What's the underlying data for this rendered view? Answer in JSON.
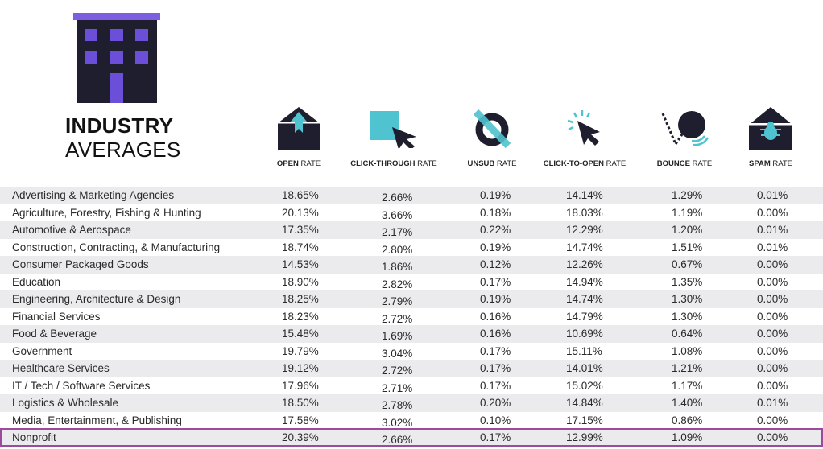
{
  "header": {
    "title_bold": "INDUSTRY",
    "title_light": "AVERAGES",
    "icon": "building-icon"
  },
  "colors": {
    "dark": "#1f1e2e",
    "accent_purple": "#6b4fd8",
    "accent_teal": "#4fc3cf",
    "highlight_border": "#9b4a9e",
    "row_shade": "#ebebed"
  },
  "columns": [
    {
      "bold": "OPEN",
      "light": " RATE",
      "icon": "envelope-open-icon"
    },
    {
      "bold": "CLICK-THROUGH",
      "light": " RATE",
      "icon": "cursor-click-icon"
    },
    {
      "bold": "UNSUB",
      "light": " RATE",
      "icon": "unsubscribe-icon"
    },
    {
      "bold": "CLICK-TO-OPEN",
      "light": " RATE",
      "icon": "cursor-sparkle-icon"
    },
    {
      "bold": "BOUNCE",
      "light": " RATE",
      "icon": "bounce-ball-icon"
    },
    {
      "bold": "SPAM",
      "light": " RATE",
      "icon": "envelope-bug-icon"
    }
  ],
  "rows": [
    {
      "industry": "Advertising & Marketing Agencies",
      "open": "18.65%",
      "ctr": "2.66%",
      "unsub": "0.19%",
      "cto": "14.14%",
      "bounce": "1.29%",
      "spam": "0.01%"
    },
    {
      "industry": "Agriculture, Forestry, Fishing & Hunting",
      "open": "20.13%",
      "ctr": "3.66%",
      "unsub": "0.18%",
      "cto": "18.03%",
      "bounce": "1.19%",
      "spam": "0.00%"
    },
    {
      "industry": "Automotive & Aerospace",
      "open": "17.35%",
      "ctr": "2.17%",
      "unsub": "0.22%",
      "cto": "12.29%",
      "bounce": "1.20%",
      "spam": "0.01%"
    },
    {
      "industry": "Construction, Contracting, & Manufacturing",
      "open": "18.74%",
      "ctr": "2.80%",
      "unsub": "0.19%",
      "cto": "14.74%",
      "bounce": "1.51%",
      "spam": "0.01%"
    },
    {
      "industry": "Consumer Packaged Goods",
      "open": "14.53%",
      "ctr": "1.86%",
      "unsub": "0.12%",
      "cto": "12.26%",
      "bounce": "0.67%",
      "spam": "0.00%"
    },
    {
      "industry": "Education",
      "open": "18.90%",
      "ctr": "2.82%",
      "unsub": "0.17%",
      "cto": "14.94%",
      "bounce": "1.35%",
      "spam": "0.00%"
    },
    {
      "industry": "Engineering, Architecture & Design",
      "open": "18.25%",
      "ctr": "2.79%",
      "unsub": "0.19%",
      "cto": "14.74%",
      "bounce": "1.30%",
      "spam": "0.00%"
    },
    {
      "industry": "Financial Services",
      "open": "18.23%",
      "ctr": "2.72%",
      "unsub": "0.16%",
      "cto": "14.79%",
      "bounce": "1.30%",
      "spam": "0.00%"
    },
    {
      "industry": "Food & Beverage",
      "open": "15.48%",
      "ctr": "1.69%",
      "unsub": "0.16%",
      "cto": "10.69%",
      "bounce": "0.64%",
      "spam": "0.00%"
    },
    {
      "industry": "Government",
      "open": "19.79%",
      "ctr": "3.04%",
      "unsub": "0.17%",
      "cto": "15.11%",
      "bounce": "1.08%",
      "spam": "0.00%"
    },
    {
      "industry": "Healthcare Services",
      "open": "19.12%",
      "ctr": "2.72%",
      "unsub": "0.17%",
      "cto": "14.01%",
      "bounce": "1.21%",
      "spam": "0.00%"
    },
    {
      "industry": "IT / Tech / Software Services",
      "open": "17.96%",
      "ctr": "2.71%",
      "unsub": "0.17%",
      "cto": "15.02%",
      "bounce": "1.17%",
      "spam": "0.00%"
    },
    {
      "industry": "Logistics & Wholesale",
      "open": "18.50%",
      "ctr": "2.78%",
      "unsub": "0.20%",
      "cto": "14.84%",
      "bounce": "1.40%",
      "spam": "0.01%"
    },
    {
      "industry": "Media, Entertainment, & Publishing",
      "open": "17.58%",
      "ctr": "3.02%",
      "unsub": "0.10%",
      "cto": "17.15%",
      "bounce": "0.86%",
      "spam": "0.00%"
    },
    {
      "industry": "Nonprofit",
      "open": "20.39%",
      "ctr": "2.66%",
      "unsub": "0.17%",
      "cto": "12.99%",
      "bounce": "1.09%",
      "spam": "0.00%",
      "highlighted": true
    }
  ]
}
